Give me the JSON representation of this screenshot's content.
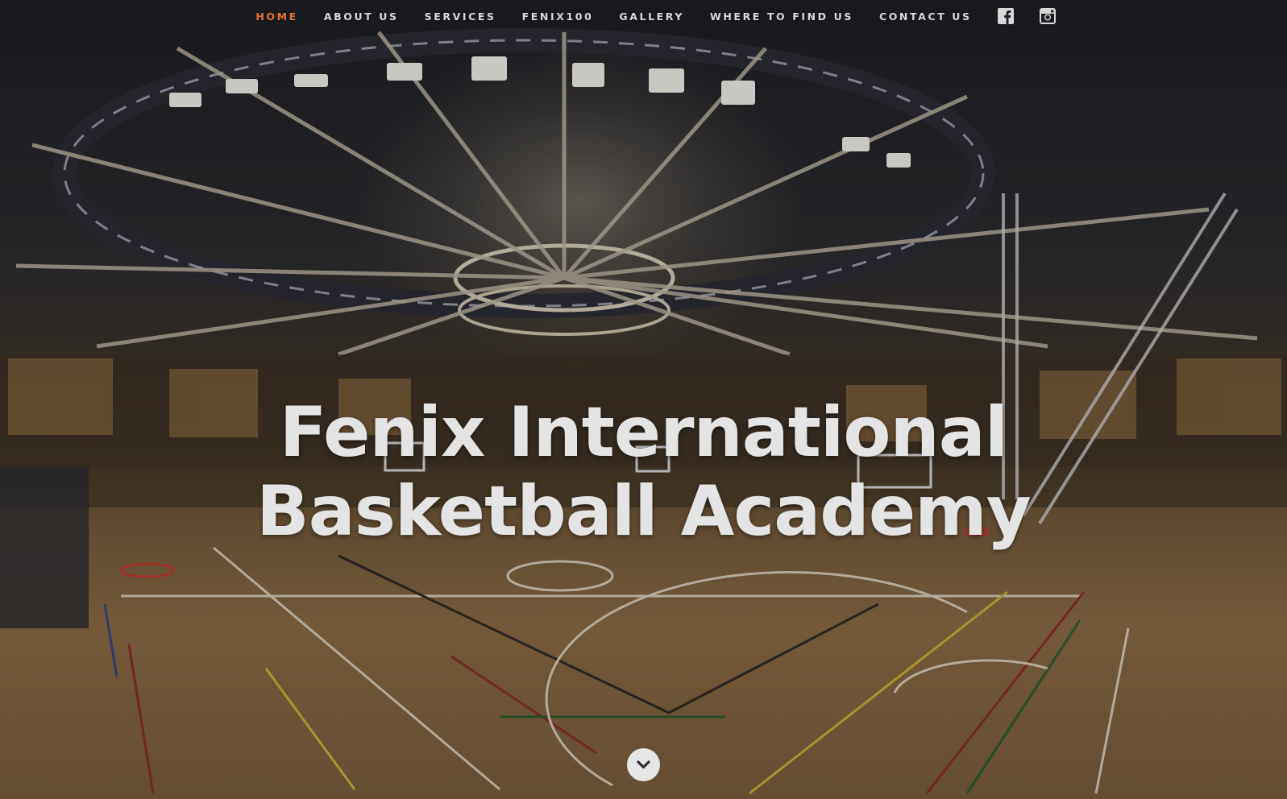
{
  "nav": {
    "items": [
      {
        "label": "HOME",
        "active": true
      },
      {
        "label": "ABOUT US",
        "active": false
      },
      {
        "label": "SERVICES",
        "active": false
      },
      {
        "label": "FENIX100",
        "active": false
      },
      {
        "label": "GALLERY",
        "active": false
      },
      {
        "label": "WHERE TO FIND US",
        "active": false
      },
      {
        "label": "CONTACT US",
        "active": false
      }
    ],
    "social": [
      {
        "icon": "facebook-icon"
      },
      {
        "icon": "instagram-icon"
      }
    ],
    "active_color": "#e0732a",
    "text_color": "#d8d8d8"
  },
  "hero": {
    "title_line1": "Fenix International",
    "title_line2": "Basketball Academy",
    "scroll_icon": "chevron-down-icon",
    "background": "basketball-arena-photo"
  }
}
